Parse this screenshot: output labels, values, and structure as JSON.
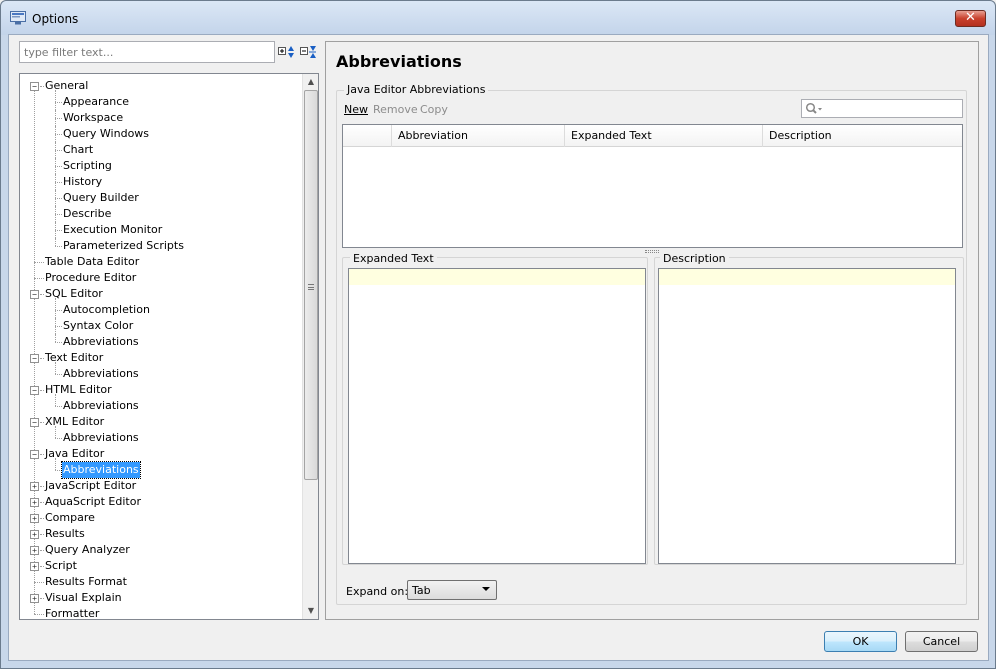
{
  "window": {
    "title": "Options",
    "close_glyph": "✕"
  },
  "filter": {
    "placeholder": "type filter text..."
  },
  "toolbar_icons": [
    "expand-all-icon",
    "collapse-all-icon"
  ],
  "tree": [
    {
      "label": "General",
      "level": 0,
      "state": "expanded"
    },
    {
      "label": "Appearance",
      "level": 1
    },
    {
      "label": "Workspace",
      "level": 1
    },
    {
      "label": "Query Windows",
      "level": 1
    },
    {
      "label": "Chart",
      "level": 1
    },
    {
      "label": "Scripting",
      "level": 1
    },
    {
      "label": "History",
      "level": 1
    },
    {
      "label": "Query Builder",
      "level": 1
    },
    {
      "label": "Describe",
      "level": 1
    },
    {
      "label": "Execution Monitor",
      "level": 1
    },
    {
      "label": "Parameterized Scripts",
      "level": 1
    },
    {
      "label": "Table Data Editor",
      "level": 0,
      "state": "leaf"
    },
    {
      "label": "Procedure Editor",
      "level": 0,
      "state": "leaf"
    },
    {
      "label": "SQL Editor",
      "level": 0,
      "state": "expanded"
    },
    {
      "label": "Autocompletion",
      "level": 1
    },
    {
      "label": "Syntax Color",
      "level": 1
    },
    {
      "label": "Abbreviations",
      "level": 1
    },
    {
      "label": "Text Editor",
      "level": 0,
      "state": "expanded"
    },
    {
      "label": "Abbreviations",
      "level": 1
    },
    {
      "label": "HTML Editor",
      "level": 0,
      "state": "expanded"
    },
    {
      "label": "Abbreviations",
      "level": 1
    },
    {
      "label": "XML Editor",
      "level": 0,
      "state": "expanded"
    },
    {
      "label": "Abbreviations",
      "level": 1
    },
    {
      "label": "Java Editor",
      "level": 0,
      "state": "expanded"
    },
    {
      "label": "Abbreviations",
      "level": 1,
      "selected": true
    },
    {
      "label": "JavaScript Editor",
      "level": 0,
      "state": "collapsed"
    },
    {
      "label": "AquaScript Editor",
      "level": 0,
      "state": "collapsed"
    },
    {
      "label": "Compare",
      "level": 0,
      "state": "collapsed"
    },
    {
      "label": "Results",
      "level": 0,
      "state": "collapsed"
    },
    {
      "label": "Query Analyzer",
      "level": 0,
      "state": "collapsed"
    },
    {
      "label": "Script",
      "level": 0,
      "state": "collapsed"
    },
    {
      "label": "Results Format",
      "level": 0,
      "state": "leaf"
    },
    {
      "label": "Visual Explain",
      "level": 0,
      "state": "collapsed"
    },
    {
      "label": "Formatter",
      "level": 0,
      "state": "leaf"
    }
  ],
  "page": {
    "title": "Abbreviations",
    "group_label": "Java Editor Abbreviations",
    "toolbar": {
      "new": "New",
      "remove": "Remove",
      "copy": "Copy"
    },
    "table_columns": [
      "Abbreviation",
      "Expanded Text",
      "Description"
    ],
    "expanded_text_label": "Expanded Text",
    "description_label": "Description",
    "expand_on_label": "Expand on:",
    "expand_on_value": "Tab"
  },
  "buttons": {
    "ok": "OK",
    "cancel": "Cancel"
  },
  "colors": {
    "selection": "#3399ff",
    "editor_highlight": "#ffffe0"
  }
}
